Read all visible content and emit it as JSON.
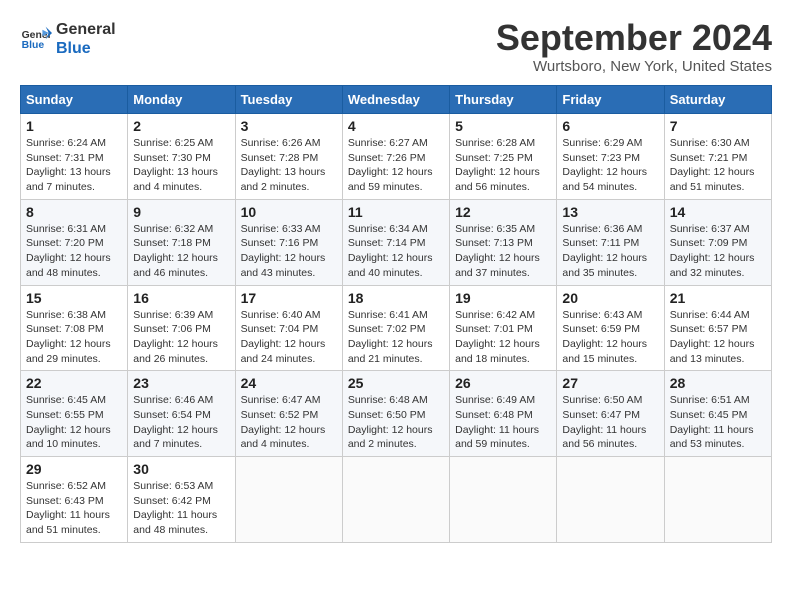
{
  "logo": {
    "line1": "General",
    "line2": "Blue"
  },
  "title": "September 2024",
  "location": "Wurtsboro, New York, United States",
  "headers": [
    "Sunday",
    "Monday",
    "Tuesday",
    "Wednesday",
    "Thursday",
    "Friday",
    "Saturday"
  ],
  "weeks": [
    [
      {
        "day": "1",
        "text": "Sunrise: 6:24 AM\nSunset: 7:31 PM\nDaylight: 13 hours\nand 7 minutes."
      },
      {
        "day": "2",
        "text": "Sunrise: 6:25 AM\nSunset: 7:30 PM\nDaylight: 13 hours\nand 4 minutes."
      },
      {
        "day": "3",
        "text": "Sunrise: 6:26 AM\nSunset: 7:28 PM\nDaylight: 13 hours\nand 2 minutes."
      },
      {
        "day": "4",
        "text": "Sunrise: 6:27 AM\nSunset: 7:26 PM\nDaylight: 12 hours\nand 59 minutes."
      },
      {
        "day": "5",
        "text": "Sunrise: 6:28 AM\nSunset: 7:25 PM\nDaylight: 12 hours\nand 56 minutes."
      },
      {
        "day": "6",
        "text": "Sunrise: 6:29 AM\nSunset: 7:23 PM\nDaylight: 12 hours\nand 54 minutes."
      },
      {
        "day": "7",
        "text": "Sunrise: 6:30 AM\nSunset: 7:21 PM\nDaylight: 12 hours\nand 51 minutes."
      }
    ],
    [
      {
        "day": "8",
        "text": "Sunrise: 6:31 AM\nSunset: 7:20 PM\nDaylight: 12 hours\nand 48 minutes."
      },
      {
        "day": "9",
        "text": "Sunrise: 6:32 AM\nSunset: 7:18 PM\nDaylight: 12 hours\nand 46 minutes."
      },
      {
        "day": "10",
        "text": "Sunrise: 6:33 AM\nSunset: 7:16 PM\nDaylight: 12 hours\nand 43 minutes."
      },
      {
        "day": "11",
        "text": "Sunrise: 6:34 AM\nSunset: 7:14 PM\nDaylight: 12 hours\nand 40 minutes."
      },
      {
        "day": "12",
        "text": "Sunrise: 6:35 AM\nSunset: 7:13 PM\nDaylight: 12 hours\nand 37 minutes."
      },
      {
        "day": "13",
        "text": "Sunrise: 6:36 AM\nSunset: 7:11 PM\nDaylight: 12 hours\nand 35 minutes."
      },
      {
        "day": "14",
        "text": "Sunrise: 6:37 AM\nSunset: 7:09 PM\nDaylight: 12 hours\nand 32 minutes."
      }
    ],
    [
      {
        "day": "15",
        "text": "Sunrise: 6:38 AM\nSunset: 7:08 PM\nDaylight: 12 hours\nand 29 minutes."
      },
      {
        "day": "16",
        "text": "Sunrise: 6:39 AM\nSunset: 7:06 PM\nDaylight: 12 hours\nand 26 minutes."
      },
      {
        "day": "17",
        "text": "Sunrise: 6:40 AM\nSunset: 7:04 PM\nDaylight: 12 hours\nand 24 minutes."
      },
      {
        "day": "18",
        "text": "Sunrise: 6:41 AM\nSunset: 7:02 PM\nDaylight: 12 hours\nand 21 minutes."
      },
      {
        "day": "19",
        "text": "Sunrise: 6:42 AM\nSunset: 7:01 PM\nDaylight: 12 hours\nand 18 minutes."
      },
      {
        "day": "20",
        "text": "Sunrise: 6:43 AM\nSunset: 6:59 PM\nDaylight: 12 hours\nand 15 minutes."
      },
      {
        "day": "21",
        "text": "Sunrise: 6:44 AM\nSunset: 6:57 PM\nDaylight: 12 hours\nand 13 minutes."
      }
    ],
    [
      {
        "day": "22",
        "text": "Sunrise: 6:45 AM\nSunset: 6:55 PM\nDaylight: 12 hours\nand 10 minutes."
      },
      {
        "day": "23",
        "text": "Sunrise: 6:46 AM\nSunset: 6:54 PM\nDaylight: 12 hours\nand 7 minutes."
      },
      {
        "day": "24",
        "text": "Sunrise: 6:47 AM\nSunset: 6:52 PM\nDaylight: 12 hours\nand 4 minutes."
      },
      {
        "day": "25",
        "text": "Sunrise: 6:48 AM\nSunset: 6:50 PM\nDaylight: 12 hours\nand 2 minutes."
      },
      {
        "day": "26",
        "text": "Sunrise: 6:49 AM\nSunset: 6:48 PM\nDaylight: 11 hours\nand 59 minutes."
      },
      {
        "day": "27",
        "text": "Sunrise: 6:50 AM\nSunset: 6:47 PM\nDaylight: 11 hours\nand 56 minutes."
      },
      {
        "day": "28",
        "text": "Sunrise: 6:51 AM\nSunset: 6:45 PM\nDaylight: 11 hours\nand 53 minutes."
      }
    ],
    [
      {
        "day": "29",
        "text": "Sunrise: 6:52 AM\nSunset: 6:43 PM\nDaylight: 11 hours\nand 51 minutes."
      },
      {
        "day": "30",
        "text": "Sunrise: 6:53 AM\nSunset: 6:42 PM\nDaylight: 11 hours\nand 48 minutes."
      },
      {
        "day": "",
        "text": ""
      },
      {
        "day": "",
        "text": ""
      },
      {
        "day": "",
        "text": ""
      },
      {
        "day": "",
        "text": ""
      },
      {
        "day": "",
        "text": ""
      }
    ]
  ]
}
